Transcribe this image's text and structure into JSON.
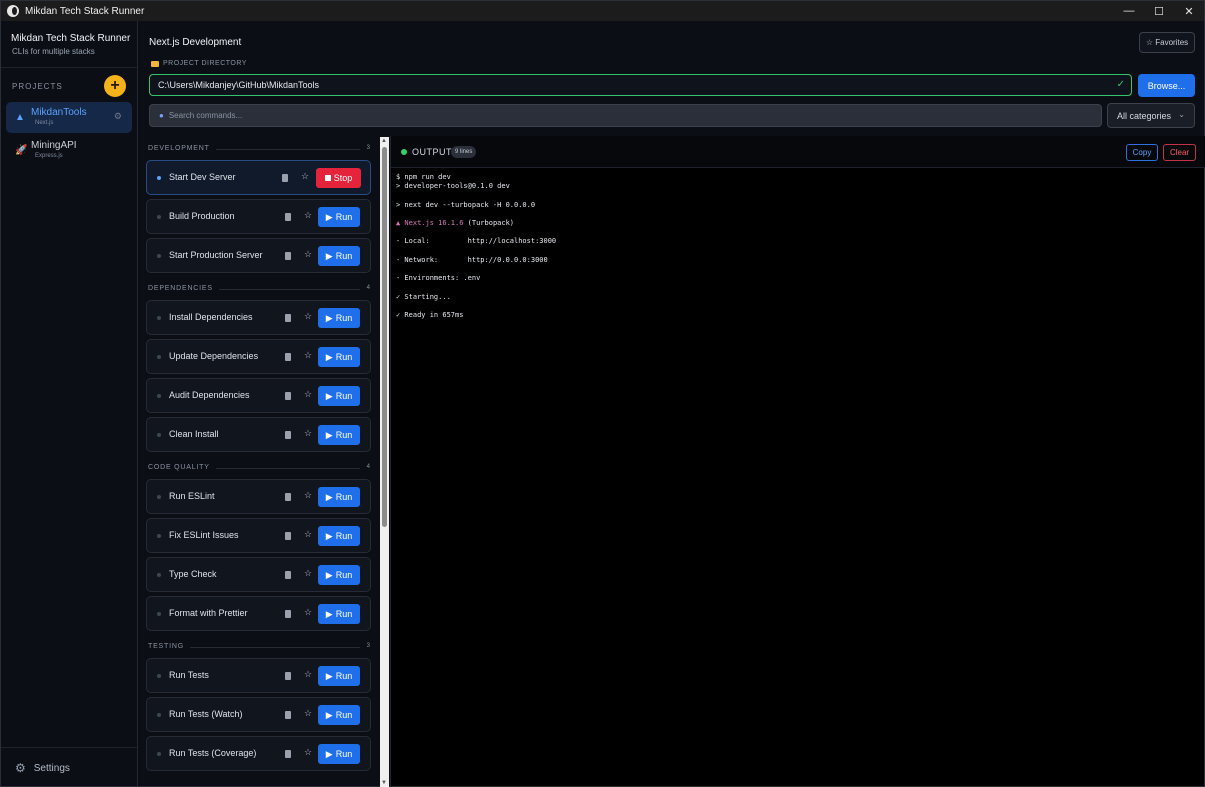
{
  "window": {
    "title": "Mikdan Tech Stack Runner",
    "controls": [
      "—",
      "☐",
      "✕"
    ]
  },
  "sidebar": {
    "brand_title": "Mikdan Tech Stack Runner",
    "brand_subtitle": "CLIs for multiple stacks",
    "projects_label": "PROJECTS",
    "add_symbol": "+",
    "projects": [
      {
        "icon": "▲",
        "name": "MikdanTools",
        "type": "Next.js",
        "active": true
      },
      {
        "icon": "🚀",
        "name": "MiningAPI",
        "type": "Express.js",
        "active": false
      }
    ],
    "settings_label": "Settings"
  },
  "header": {
    "title": "Next.js Development",
    "favorites_label": "☆ Favorites",
    "dir_label": "PROJECT DIRECTORY",
    "dir_value": "C:\\Users\\Mikdanjey\\GitHub\\MikdanTools",
    "dir_check": "✓",
    "browse_label": "Browse...",
    "search_placeholder": "Search commands...",
    "category_selected": "All categories"
  },
  "sections": [
    {
      "label": "DEVELOPMENT",
      "count": "3",
      "commands": [
        "Start Dev Server",
        "Build Production",
        "Start Production Server"
      ]
    },
    {
      "label": "DEPENDENCIES",
      "count": "4",
      "commands": [
        "Install Dependencies",
        "Update Dependencies",
        "Audit Dependencies",
        "Clean Install"
      ]
    },
    {
      "label": "CODE QUALITY",
      "count": "4",
      "commands": [
        "Run ESLint",
        "Fix ESLint Issues",
        "Type Check",
        "Format with Prettier"
      ]
    },
    {
      "label": "TESTING",
      "count": "3",
      "commands": [
        "Run Tests",
        "Run Tests (Watch)",
        "Run Tests (Coverage)"
      ]
    }
  ],
  "buttons": {
    "run_label": "Run",
    "stop_label": "Stop",
    "run_icon": "▶",
    "star": "☆"
  },
  "output": {
    "title": "OUTPUT",
    "lines_badge": "9 lines",
    "copy_label": "Copy",
    "clear_label": "Clear",
    "lines": [
      "$ npm run dev",
      "> developer-tools@0.1.0 dev",
      "",
      "> next dev --turbopack -H 0.0.0.0",
      "",
      "▲ Next.js 16.1.6 (Turbopack)",
      "",
      "- Local:         http://localhost:3000",
      "",
      "- Network:       http://0.0.0.0:3000",
      "",
      "- Environments: .env",
      "",
      "✓ Starting...",
      "",
      "✓ Ready in 657ms"
    ]
  },
  "colors": {
    "accent": "#1f6feb",
    "stop": "#e5243b",
    "success": "#35c46a",
    "add_button": "#f5b31b"
  }
}
